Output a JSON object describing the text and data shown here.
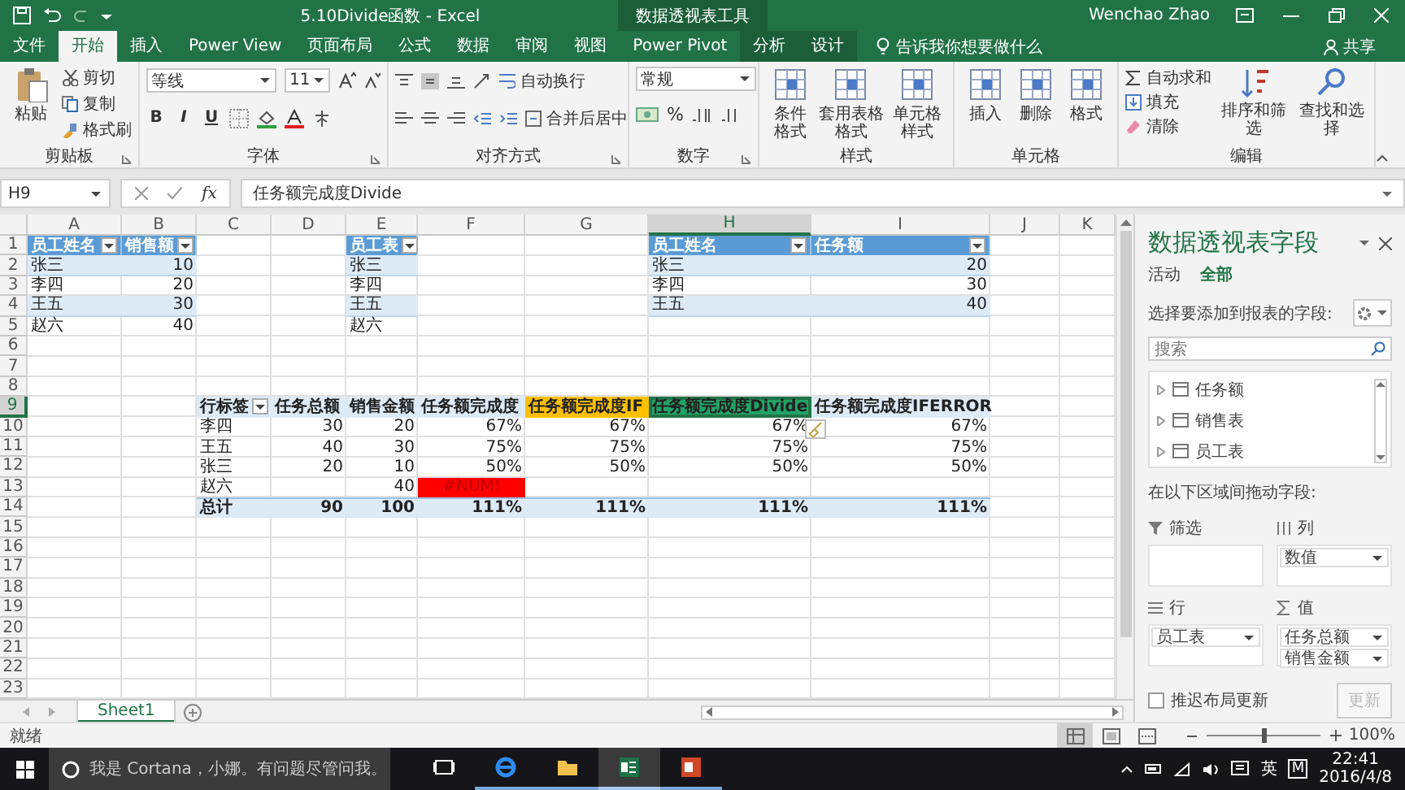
{
  "title_bar": {
    "title": "5.10Divide函数 - Excel",
    "context_label": "数据透视表工具",
    "user": "Wenchao Zhao"
  },
  "ribbon_tabs": [
    {
      "label": "文件",
      "selected": false,
      "kind": "file"
    },
    {
      "label": "开始",
      "selected": true,
      "kind": "main"
    },
    {
      "label": "插入",
      "selected": false,
      "kind": "main"
    },
    {
      "label": "Power View",
      "selected": false,
      "kind": "main"
    },
    {
      "label": "页面布局",
      "selected": false,
      "kind": "main"
    },
    {
      "label": "公式",
      "selected": false,
      "kind": "main"
    },
    {
      "label": "数据",
      "selected": false,
      "kind": "main"
    },
    {
      "label": "审阅",
      "selected": false,
      "kind": "main"
    },
    {
      "label": "视图",
      "selected": false,
      "kind": "main"
    },
    {
      "label": "Power Pivot",
      "selected": false,
      "kind": "main"
    },
    {
      "label": "分析",
      "selected": false,
      "kind": "context"
    },
    {
      "label": "设计",
      "selected": false,
      "kind": "context"
    }
  ],
  "tell_me": "告诉我你想要做什么",
  "share": "共享",
  "ribbon_groups": [
    {
      "label": "剪贴板",
      "kind": "clipboard",
      "big": "粘贴",
      "items": [
        {
          "label": "剪切"
        },
        {
          "label": "复制"
        },
        {
          "label": "格式刷"
        }
      ]
    },
    {
      "label": "字体",
      "kind": "font",
      "font": "等线",
      "size": "11",
      "format_buttons": [
        "B",
        "I",
        "U"
      ]
    },
    {
      "label": "对齐方式",
      "kind": "align",
      "items": [
        {
          "label": "自动换行"
        },
        {
          "label": "合并后居中"
        }
      ]
    },
    {
      "label": "数字",
      "kind": "number",
      "format": "常规",
      "percent": "%"
    },
    {
      "label": "样式",
      "kind": "large",
      "items": [
        {
          "label": "条件格式"
        },
        {
          "label": "套用表格格式"
        },
        {
          "label": "单元格样式"
        }
      ]
    },
    {
      "label": "单元格",
      "kind": "large",
      "items": [
        {
          "label": "插入"
        },
        {
          "label": "删除"
        },
        {
          "label": "格式"
        }
      ]
    },
    {
      "label": "编辑",
      "kind": "edit",
      "items": [
        {
          "label": "自动求和"
        },
        {
          "label": "填充"
        },
        {
          "label": "清除"
        }
      ],
      "large": [
        {
          "label": "排序和筛选"
        },
        {
          "label": "查找和选择"
        }
      ]
    }
  ],
  "formula_bar": {
    "name_box": "H9",
    "function_label": "fx",
    "formula": "任务额完成度Divide"
  },
  "sheet": {
    "columns": [
      {
        "label": "A",
        "selected": false
      },
      {
        "label": "B",
        "selected": false
      },
      {
        "label": "C",
        "selected": false
      },
      {
        "label": "D",
        "selected": false
      },
      {
        "label": "E",
        "selected": false
      },
      {
        "label": "F",
        "selected": false
      },
      {
        "label": "G",
        "selected": false
      },
      {
        "label": "H",
        "selected": true
      },
      {
        "label": "I",
        "selected": false
      },
      {
        "label": "J",
        "selected": false
      },
      {
        "label": "K",
        "selected": false
      }
    ],
    "rows": [
      {
        "number": "1",
        "selected": false,
        "cells": [
          {
            "text": "员工姓名",
            "kind": "header",
            "filter": true
          },
          {
            "text": "销售额",
            "kind": "header",
            "filter": true
          },
          null,
          null,
          {
            "text": "员工表",
            "kind": "header",
            "filter": true
          },
          null,
          null,
          {
            "text": "员工姓名",
            "kind": "header",
            "filter": true
          },
          {
            "text": "任务额",
            "kind": "header",
            "filter": true
          },
          null,
          null
        ]
      },
      {
        "number": "2",
        "selected": false,
        "cells": [
          {
            "text": "张三",
            "kind": "band"
          },
          {
            "text": "10",
            "kind": "band-number"
          },
          null,
          null,
          {
            "text": "张三",
            "kind": "band"
          },
          null,
          null,
          {
            "text": "张三",
            "kind": "band"
          },
          {
            "text": "20",
            "kind": "band-number"
          },
          null,
          null
        ]
      },
      {
        "number": "3",
        "selected": false,
        "cells": [
          {
            "text": "李四",
            "kind": "text"
          },
          {
            "text": "20",
            "kind": "number"
          },
          null,
          null,
          {
            "text": "李四",
            "kind": "text"
          },
          null,
          null,
          {
            "text": "李四",
            "kind": "text"
          },
          {
            "text": "30",
            "kind": "number"
          },
          null,
          null
        ]
      },
      {
        "number": "4",
        "selected": false,
        "cells": [
          {
            "text": "王五",
            "kind": "band"
          },
          {
            "text": "30",
            "kind": "band-number"
          },
          null,
          null,
          {
            "text": "王五",
            "kind": "band"
          },
          null,
          null,
          {
            "text": "王五",
            "kind": "band"
          },
          {
            "text": "40",
            "kind": "band-number"
          },
          null,
          null
        ]
      },
      {
        "number": "5",
        "selected": false,
        "cells": [
          {
            "text": "赵六",
            "kind": "text"
          },
          {
            "text": "40",
            "kind": "number"
          },
          null,
          null,
          {
            "text": "赵六",
            "kind": "text"
          },
          null,
          null,
          null,
          null,
          null,
          null
        ]
      },
      {
        "number": "6",
        "selected": false
      },
      {
        "number": "7",
        "selected": false
      },
      {
        "number": "8",
        "selected": false
      },
      {
        "number": "9",
        "selected": true,
        "cells": [
          null,
          null,
          {
            "text": "行标签",
            "kind": "pivot",
            "filter": true
          },
          {
            "text": "任务总额",
            "kind": "pivot"
          },
          {
            "text": "销售金额",
            "kind": "pivot"
          },
          {
            "text": "任务额完成度",
            "kind": "pivot"
          },
          {
            "text": "任务额完成度IF",
            "kind": "orange"
          },
          {
            "text": "任务额完成度Divide",
            "kind": "green"
          },
          {
            "text": "任务额完成度IFERROR",
            "kind": "pivot"
          },
          null,
          null
        ]
      },
      {
        "number": "10",
        "selected": false,
        "cells": [
          null,
          null,
          {
            "text": "李四",
            "kind": "text"
          },
          {
            "text": "30",
            "kind": "number"
          },
          {
            "text": "20",
            "kind": "number"
          },
          {
            "text": "67%",
            "kind": "number"
          },
          {
            "text": "67%",
            "kind": "number"
          },
          {
            "text": "67%",
            "kind": "number"
          },
          {
            "text": "67%",
            "kind": "number"
          },
          null,
          null
        ]
      },
      {
        "number": "11",
        "selected": false,
        "cells": [
          null,
          null,
          {
            "text": "王五",
            "kind": "text"
          },
          {
            "text": "40",
            "kind": "number"
          },
          {
            "text": "30",
            "kind": "number"
          },
          {
            "text": "75%",
            "kind": "number"
          },
          {
            "text": "75%",
            "kind": "number"
          },
          {
            "text": "75%",
            "kind": "number"
          },
          {
            "text": "75%",
            "kind": "number"
          },
          null,
          null
        ]
      },
      {
        "number": "12",
        "selected": false,
        "cells": [
          null,
          null,
          {
            "text": "张三",
            "kind": "text"
          },
          {
            "text": "20",
            "kind": "number"
          },
          {
            "text": "10",
            "kind": "number"
          },
          {
            "text": "50%",
            "kind": "number"
          },
          {
            "text": "50%",
            "kind": "number"
          },
          {
            "text": "50%",
            "kind": "number"
          },
          {
            "text": "50%",
            "kind": "number"
          },
          null,
          null
        ]
      },
      {
        "number": "13",
        "selected": false,
        "cells": [
          null,
          null,
          {
            "text": "赵六",
            "kind": "text"
          },
          null,
          {
            "text": "40",
            "kind": "number"
          },
          {
            "text": "#NUM!",
            "kind": "error"
          },
          null,
          null,
          null,
          null,
          null
        ]
      },
      {
        "number": "14",
        "selected": false,
        "cells": [
          null,
          null,
          {
            "text": "总计",
            "kind": "total"
          },
          {
            "text": "90",
            "kind": "total-number"
          },
          {
            "text": "100",
            "kind": "total-number"
          },
          {
            "text": "111%",
            "kind": "total-number"
          },
          {
            "text": "111%",
            "kind": "total-number"
          },
          {
            "text": "111%",
            "kind": "total-number"
          },
          {
            "text": "111%",
            "kind": "total-number"
          },
          null,
          null
        ]
      },
      {
        "number": "15",
        "selected": false
      },
      {
        "number": "16",
        "selected": false
      },
      {
        "number": "17",
        "selected": false
      },
      {
        "number": "18",
        "selected": false
      },
      {
        "number": "19",
        "selected": false
      },
      {
        "number": "20",
        "selected": false
      },
      {
        "number": "21",
        "selected": false
      },
      {
        "number": "22",
        "selected": false
      },
      {
        "number": "23",
        "selected": false
      }
    ]
  },
  "sheet_tabs": [
    {
      "label": "Sheet1",
      "selected": true
    }
  ],
  "pivot_pane": {
    "title": "数据透视表字段",
    "tabs": [
      {
        "label": "活动",
        "selected": false
      },
      {
        "label": "全部",
        "selected": true
      }
    ],
    "prompt": "选择要添加到报表的字段:",
    "search": {
      "placeholder": "搜索"
    },
    "fields": [
      {
        "label": "任务额",
        "expanded": false
      },
      {
        "label": "销售表",
        "expanded": false
      },
      {
        "label": "员工表",
        "expanded": false
      }
    ],
    "areas_label": "在以下区域间拖动字段:",
    "areas": [
      {
        "label": "筛选",
        "kind": "filter"
      },
      {
        "label": "列",
        "kind": "columns",
        "items": [
          "数值"
        ]
      },
      {
        "label": "行",
        "kind": "rows",
        "items": [
          "员工表"
        ]
      },
      {
        "label": "值",
        "kind": "values",
        "items": [
          "任务总额",
          "销售金额"
        ]
      }
    ],
    "defer": {
      "label": "推迟布局更新",
      "checked": false
    },
    "update_button": {
      "label": "更新",
      "disabled": true
    }
  },
  "status_bar": {
    "text": "就绪",
    "view_buttons": [
      {
        "kind": "normal",
        "selected": true
      },
      {
        "kind": "layout",
        "selected": false
      },
      {
        "kind": "break",
        "selected": false
      }
    ],
    "zoom_slider": {
      "level": 0.5
    },
    "zoom": "100%"
  },
  "taskbar": {
    "search_placeholder": "我是 Cortana，小娜。有问题尽管问我。",
    "apps": [
      {
        "kind": "taskview",
        "active": false
      },
      {
        "kind": "browser",
        "active": false
      },
      {
        "kind": "folder",
        "active": false
      },
      {
        "kind": "excel",
        "active": true
      },
      {
        "kind": "powerpoint",
        "active": false
      }
    ],
    "ime": "英",
    "ime_mode": "M",
    "time": "22:41",
    "date": "2016/4/8"
  }
}
